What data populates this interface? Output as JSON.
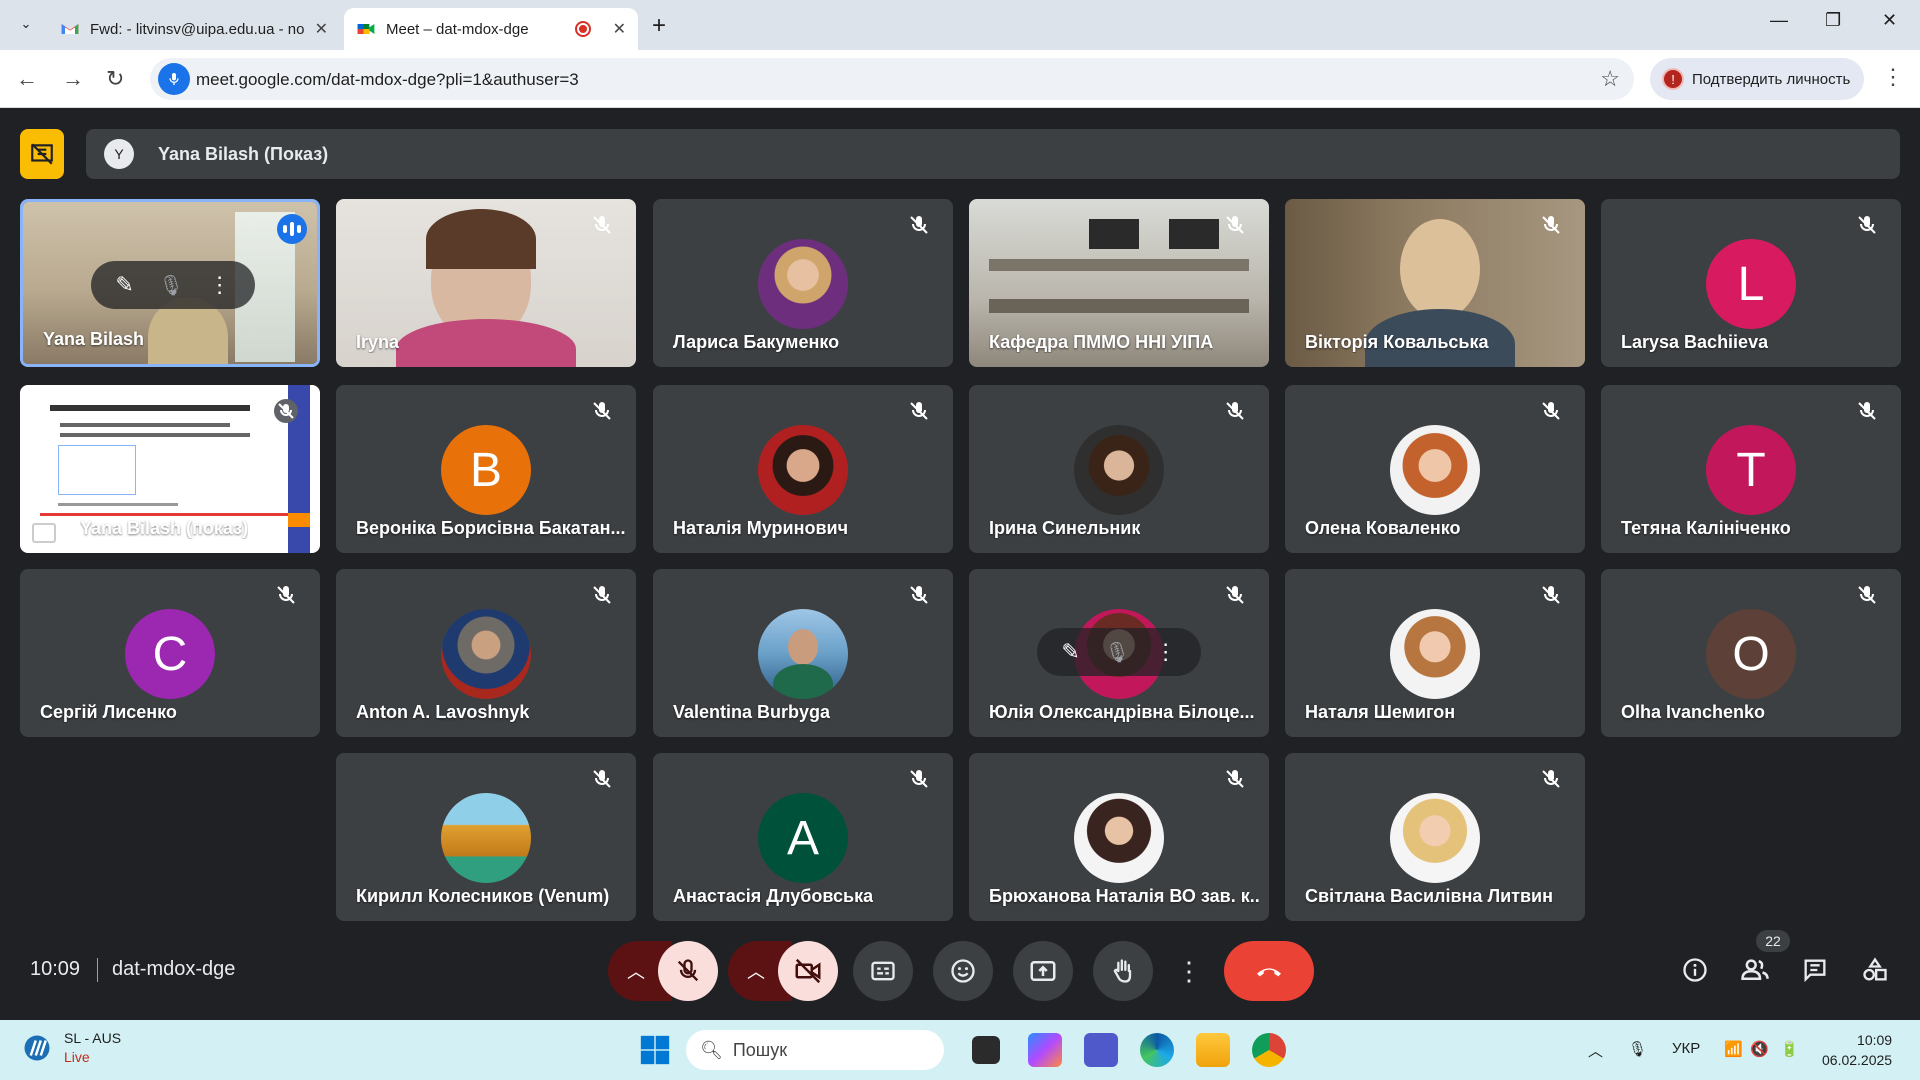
{
  "browser": {
    "tabs": [
      {
        "title": "Fwd: - litvinsv@uipa.edu.ua - no",
        "icon": "gmail-icon",
        "active": false
      },
      {
        "title": "Meet – dat-mdox-dge",
        "icon": "meet-icon",
        "active": true
      }
    ],
    "url": "meet.google.com/dat-mdox-dge?pli=1&authuser=3",
    "verify_label": "Подтвердить личность",
    "verify_badge": "!"
  },
  "meet": {
    "presentation_label": "Yana Bilash (Показ)",
    "presenter_avatar_letter": "Y",
    "time": "10:09",
    "meeting_code": "dat-mdox-dge",
    "people_count": "22",
    "participants": [
      {
        "name": "Yana Bilash",
        "type": "video"
      },
      {
        "name": "Iryna",
        "type": "video"
      },
      {
        "name": "Лариса Бакуменко",
        "type": "photo"
      },
      {
        "name": "Кафедра ПММО ННІ УІПА",
        "type": "video"
      },
      {
        "name": "Вікторія Ковальська",
        "type": "video"
      },
      {
        "name": "Larysa Bachiieva",
        "type": "letter",
        "letter": "L",
        "color": "#d81b60"
      },
      {
        "name": "Yana Bilash (показ)",
        "type": "screen"
      },
      {
        "name": "Вероніка Борисівна Бакатан...",
        "type": "letter",
        "letter": "B",
        "color": "#e8710a"
      },
      {
        "name": "Наталія Муринович",
        "type": "photo"
      },
      {
        "name": "Ірина Синельник",
        "type": "photo"
      },
      {
        "name": "Олена Коваленко",
        "type": "photo"
      },
      {
        "name": "Тетяна Калініченко",
        "type": "letter",
        "letter": "T",
        "color": "#c2185b"
      },
      {
        "name": "Сергій Лисенко",
        "type": "letter",
        "letter": "C",
        "color": "#9c27b0"
      },
      {
        "name": "Anton A. Lavoshnyk",
        "type": "photo"
      },
      {
        "name": "Valentina Burbyga",
        "type": "photo"
      },
      {
        "name": "Юлія Олександрівна Білоце...",
        "type": "photo"
      },
      {
        "name": "Наталя Шемигон",
        "type": "photo"
      },
      {
        "name": "Olha Ivanchenko",
        "type": "letter",
        "letter": "O",
        "color": "#5d4037"
      },
      {
        "name": "Кирилл Колесников (Venum)",
        "type": "photo"
      },
      {
        "name": "Анастасія Длубовська",
        "type": "letter",
        "letter": "A",
        "color": "#00513a"
      },
      {
        "name": "Брюханова Наталія ВО зав. к...",
        "type": "photo"
      },
      {
        "name": "Світлана Василівна Литвин",
        "type": "photo"
      }
    ]
  },
  "taskbar": {
    "weather_title": "SL - AUS",
    "weather_sub": "Live",
    "search_placeholder": "Пошук",
    "language": "УКР",
    "time": "10:09",
    "date": "06.02.2025"
  }
}
